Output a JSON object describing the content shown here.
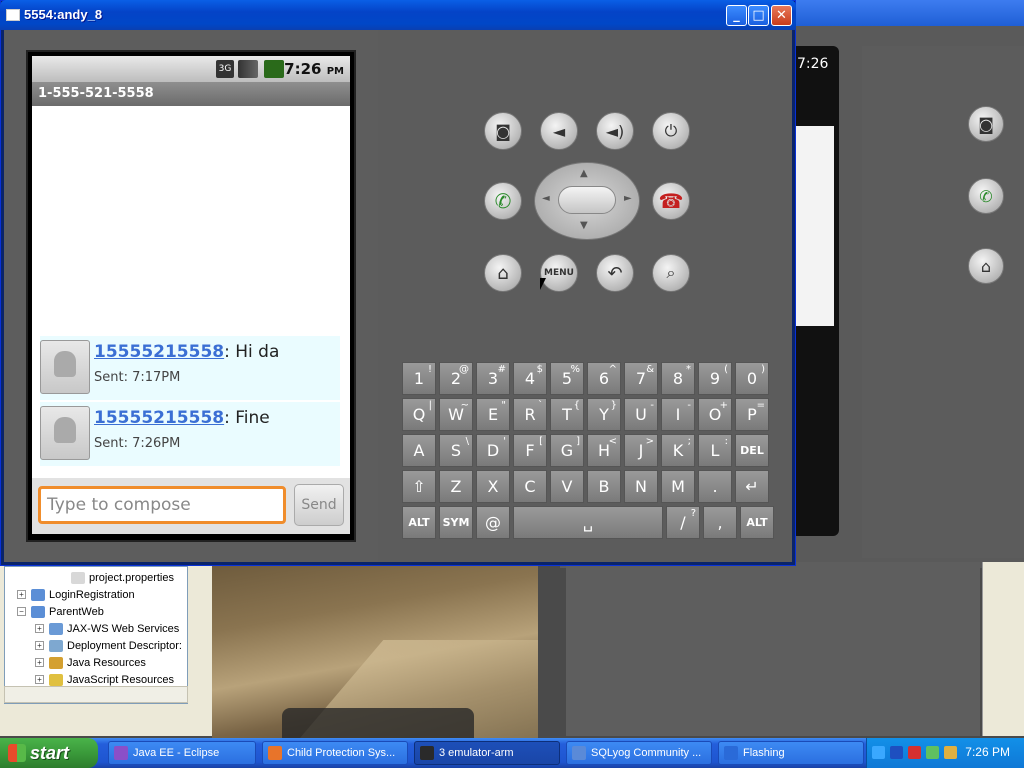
{
  "window": {
    "title": "5554:andy_8"
  },
  "window_buttons": {
    "minimize": "_",
    "maximize": "□",
    "close": "✕"
  },
  "phone": {
    "status_time": "7:26",
    "status_ampm": "PM",
    "status_3g": "3G",
    "header": "1-555-521-5558",
    "messages": [
      {
        "sender": "15555215558",
        "text": ": Hi da",
        "sent": "Sent: 7:17PM"
      },
      {
        "sender": "15555215558",
        "text": ": Fine",
        "sent": "Sent: 7:26PM"
      }
    ],
    "compose_placeholder": "Type to compose",
    "send_label": "Send"
  },
  "controls": {
    "camera": "camera-icon",
    "vol_down": "volume-down-icon",
    "vol_up": "volume-up-icon",
    "power": "power-icon",
    "call": "call-icon",
    "end_call": "end-call-icon",
    "home": "home-icon",
    "menu": "MENU",
    "back": "back-icon",
    "search": "search-icon"
  },
  "keyboard": {
    "row1": [
      [
        "1",
        "!"
      ],
      [
        "2",
        "@"
      ],
      [
        "3",
        "#"
      ],
      [
        "4",
        "$"
      ],
      [
        "5",
        "%"
      ],
      [
        "6",
        "^"
      ],
      [
        "7",
        "&"
      ],
      [
        "8",
        "*"
      ],
      [
        "9",
        "("
      ],
      [
        "0",
        ")"
      ]
    ],
    "row2": [
      [
        "Q",
        "|"
      ],
      [
        "W",
        "~"
      ],
      [
        "E",
        "\""
      ],
      [
        "R",
        "`"
      ],
      [
        "T",
        "{"
      ],
      [
        "Y",
        "}"
      ],
      [
        "U",
        "-"
      ],
      [
        "I",
        "-"
      ],
      [
        "O",
        "+"
      ],
      [
        "P",
        "="
      ]
    ],
    "row3": [
      [
        "A",
        ""
      ],
      [
        "S",
        "\\"
      ],
      [
        "D",
        "'"
      ],
      [
        "F",
        "["
      ],
      [
        "G",
        "]"
      ],
      [
        "H",
        "<"
      ],
      [
        "J",
        ">"
      ],
      [
        "K",
        ";"
      ],
      [
        "L",
        ":"
      ],
      [
        "DEL",
        ""
      ]
    ],
    "row4": [
      [
        "⇧",
        ""
      ],
      [
        "Z",
        ""
      ],
      [
        "X",
        ""
      ],
      [
        "C",
        ""
      ],
      [
        "V",
        ""
      ],
      [
        "B",
        ""
      ],
      [
        "N",
        ""
      ],
      [
        "M",
        ""
      ],
      [
        ".",
        ""
      ],
      [
        "↵",
        ""
      ]
    ],
    "row5": [
      [
        "ALT",
        ""
      ],
      [
        "SYM",
        ""
      ],
      [
        "@",
        ""
      ],
      [
        "␣",
        ""
      ],
      [
        "/",
        "?"
      ],
      [
        ",",
        ""
      ],
      [
        "ALT",
        ""
      ]
    ]
  },
  "bg_emulator": {
    "time": "7:26"
  },
  "eclipse_tree": [
    {
      "label": "project.properties",
      "indent": 2,
      "exp": ""
    },
    {
      "label": "LoginRegistration",
      "indent": 0,
      "exp": "+"
    },
    {
      "label": "ParentWeb",
      "indent": 0,
      "exp": "−"
    },
    {
      "label": "JAX-WS Web Services",
      "indent": 1,
      "exp": "+"
    },
    {
      "label": "Deployment Descriptor:",
      "indent": 1,
      "exp": "+"
    },
    {
      "label": "Java Resources",
      "indent": 1,
      "exp": "+"
    },
    {
      "label": "JavaScript Resources",
      "indent": 1,
      "exp": "+"
    }
  ],
  "taskbar": {
    "start": "start",
    "tasks": [
      {
        "label": "Java EE - Eclipse",
        "active": false
      },
      {
        "label": "Child Protection Sys...",
        "active": false
      },
      {
        "label": "3 emulator-arm",
        "active": true
      },
      {
        "label": "SQLyog Community ...",
        "active": false
      },
      {
        "label": "Flashing",
        "active": false
      }
    ],
    "clock": "7:26 PM"
  },
  "colors": {
    "xp_blue": "#245edb",
    "start_green": "#3a9a3a",
    "compose_border": "#f08d2c",
    "link_blue": "#3b6fd4"
  }
}
